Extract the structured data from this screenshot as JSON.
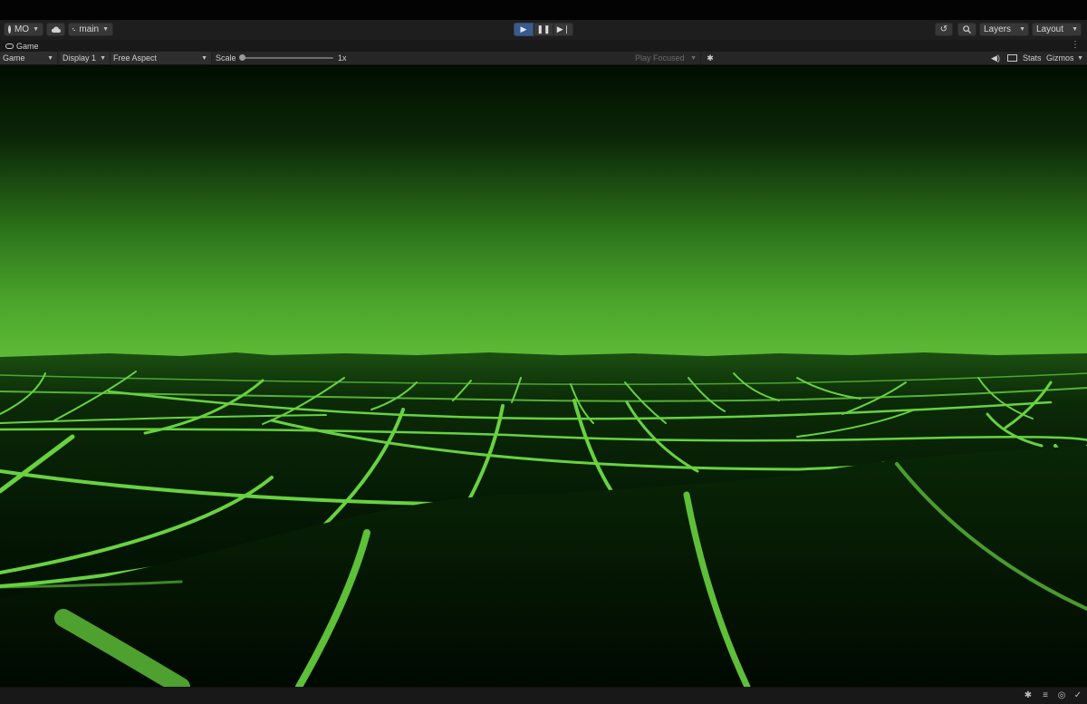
{
  "toolbar": {
    "account_label": "MO",
    "branch_label": "main",
    "layers_label": "Layers",
    "layout_label": "Layout",
    "icons": [
      "account-icon",
      "cloud-icon",
      "branch-icon",
      "play-icon",
      "pause-icon",
      "step-icon",
      "history-icon",
      "search-icon"
    ]
  },
  "panel": {
    "tab_label": "Game"
  },
  "game_bar": {
    "view_mode": "Game",
    "display": "Display 1",
    "aspect": "Free Aspect",
    "scale_label": "Scale",
    "scale_value": "1x",
    "scale_fraction": 0.0,
    "play_mode": "Play Focused",
    "stats_label": "Stats",
    "gizmos_label": "Gizmos"
  },
  "colors": {
    "accent_play": "#3a5b8a",
    "scene_glow": "#62c83a",
    "scene_lines": "#6fe043",
    "scene_dark": "#021202"
  },
  "status_icons": [
    "bug-icon",
    "database-icon",
    "network-icon",
    "check-circle-icon"
  ]
}
